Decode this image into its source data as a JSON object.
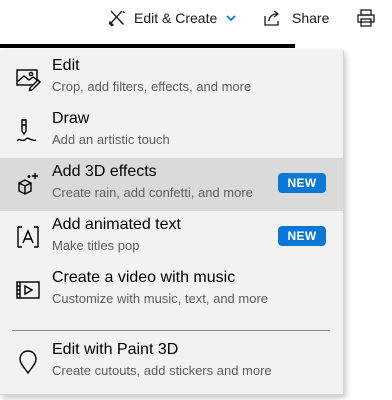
{
  "toolbar": {
    "edit_create_label": "Edit & Create",
    "share_label": "Share",
    "icons": {
      "edit_create": "magic-brush-icon",
      "share": "share-icon",
      "print": "print-icon",
      "dropdown": "chevron-down-icon"
    }
  },
  "menu": {
    "items": [
      {
        "title": "Edit",
        "subtitle": "Crop, add filters, effects, and more",
        "icon": "image-edit-icon",
        "badge": "",
        "highlighted": false
      },
      {
        "title": "Draw",
        "subtitle": "Add an artistic touch",
        "icon": "pen-draw-icon",
        "badge": "",
        "highlighted": false
      },
      {
        "title": "Add 3D effects",
        "subtitle": "Create rain, add confetti, and more",
        "icon": "3d-effects-icon",
        "badge": "NEW",
        "highlighted": true
      },
      {
        "title": "Add animated text",
        "subtitle": "Make titles pop",
        "icon": "animated-text-icon",
        "badge": "NEW",
        "highlighted": false
      },
      {
        "title": "Create a video with music",
        "subtitle": "Customize with music, text, and more",
        "icon": "video-music-icon",
        "badge": "",
        "highlighted": false
      },
      {
        "title": "Edit with Paint 3D",
        "subtitle": "Create cutouts, add stickers and more",
        "icon": "paint-3d-icon",
        "badge": "",
        "highlighted": false
      }
    ]
  },
  "colors": {
    "accent": "#0a78d4",
    "menu_bg": "#f2f2f2",
    "highlight": "#dadada"
  }
}
